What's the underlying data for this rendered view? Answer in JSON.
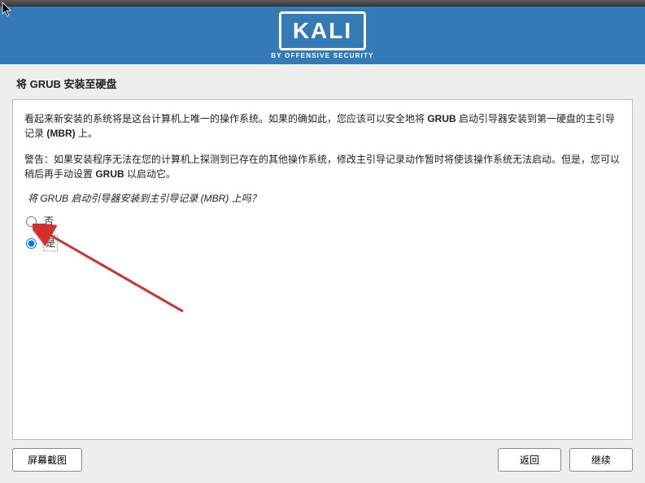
{
  "header": {
    "logo_text": "KALI",
    "logo_subtitle": "BY OFFENSIVE SECURITY"
  },
  "page_title": "将 GRUB 安装至硬盘",
  "content": {
    "description_pre": "看起来新安装的系统将是这台计算机上唯一的操作系统。如果的确如此，您应该可以安全地将 ",
    "description_bold1": "GRUB",
    "description_mid": " 启动引导器安装到第一硬盘的主引导记录 ",
    "description_bold2": "(MBR)",
    "description_post": " 上。",
    "warning_pre": "警告：如果安装程序无法在您的计算机上探测到已存在的其他操作系统，修改主引导记录动作暂时将使该操作系统无法启动。但是，您可以稍后再手动设置 ",
    "warning_bold": "GRUB",
    "warning_post": " 以启动它。",
    "question": "将 GRUB 启动引导器安装到主引导记录 (MBR) 上吗？"
  },
  "options": {
    "no": "否",
    "yes": "是"
  },
  "buttons": {
    "screenshot": "屏幕截图",
    "back": "返回",
    "continue": "继续"
  }
}
